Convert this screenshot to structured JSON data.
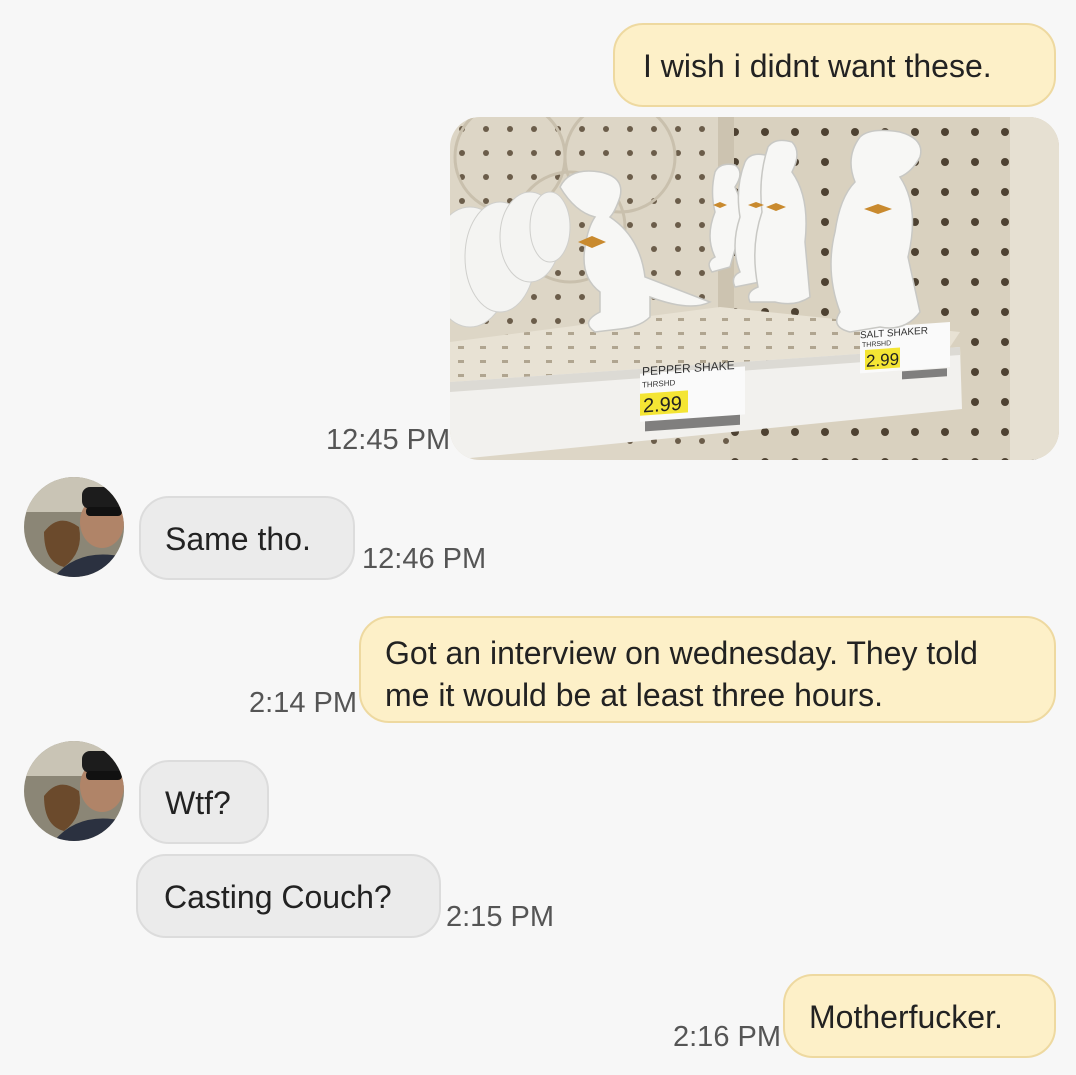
{
  "messages": {
    "m1": {
      "text": "I wish i didnt want these.",
      "time": ""
    },
    "m2": {
      "time": "12:45 PM",
      "image_alt": "Ceramic dinosaur salt and pepper shakers on a store shelf",
      "price_left": "2.99",
      "label_left": "PEPPER SHAKE",
      "sub_left": "THRSHD",
      "price_right": "2.99",
      "label_right": "SALT SHAKER",
      "sub_right": "THRSHD"
    },
    "m3": {
      "text": "Same tho.",
      "time": "12:46 PM"
    },
    "m4": {
      "line1": "Got an interview on wednesday. They told",
      "line2": "me it would be at least three hours.",
      "time": "2:14 PM"
    },
    "m5": {
      "text": "Wtf?"
    },
    "m6": {
      "text": "Casting Couch?",
      "time": "2:15 PM"
    },
    "m7": {
      "text": "Motherfucker.",
      "time": "2:16 PM"
    }
  },
  "colors": {
    "sent_bubble": "#fdf0c8",
    "received_bubble": "#ebebeb",
    "background": "#f7f7f7"
  }
}
